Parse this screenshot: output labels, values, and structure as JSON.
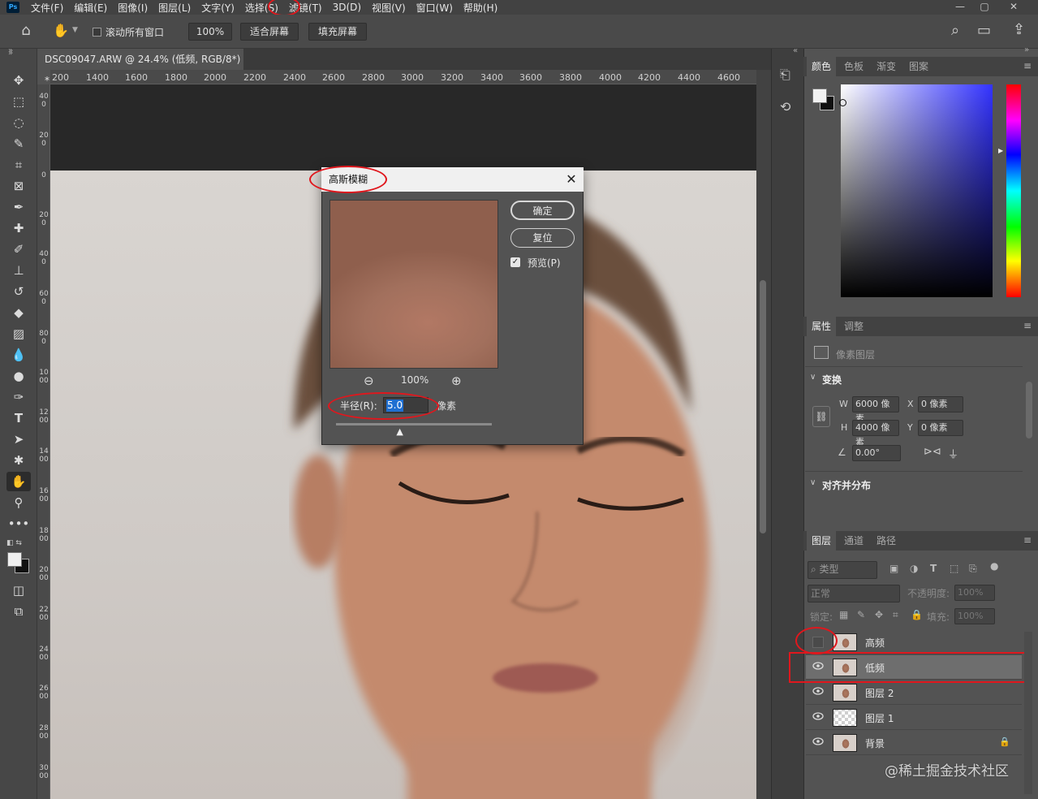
{
  "menubar": {
    "app_icon": "Ps",
    "items": [
      "文件(F)",
      "编辑(E)",
      "图像(I)",
      "图层(L)",
      "文字(Y)",
      "选择(S)",
      "滤镜(T)",
      "3D(D)",
      "视图(V)",
      "窗口(W)",
      "帮助(H)"
    ],
    "win_minimize": "—",
    "win_restore": "▢",
    "win_close": "✕"
  },
  "optionsbar": {
    "home_icon": "⌂",
    "hand_icon": "✋",
    "scroll_all_label": "滚动所有窗口",
    "zoom_value": "100%",
    "fit_screen_label": "适合屏幕",
    "fill_screen_label": "填充屏幕",
    "search_icon": "⌕",
    "workspace_icon": "▭",
    "share_icon": "⇪"
  },
  "document": {
    "tab_title": "DSC09047.ARW @ 24.4% (低频, RGB/8*) *",
    "tab_close": "×",
    "ruler_top": [
      "200",
      "1400",
      "1600",
      "1800",
      "2000",
      "2200",
      "2400",
      "2600",
      "2800",
      "3000",
      "3200",
      "3400",
      "3600",
      "3800",
      "4000",
      "4200",
      "4400",
      "4600"
    ],
    "ruler_left": [
      "400",
      "200",
      "0",
      "200",
      "400",
      "600",
      "800",
      "1000",
      "1200",
      "1400",
      "1600",
      "1800",
      "2000",
      "2200",
      "2400",
      "2600",
      "2800",
      "3000"
    ]
  },
  "dialog": {
    "title": "高斯模糊",
    "close": "✕",
    "ok_label": "确定",
    "reset_label": "复位",
    "preview_label": "预览(P)",
    "preview_checked": "✓",
    "zoom_out_icon": "⊖",
    "zoom_value": "100%",
    "zoom_in_icon": "⊕",
    "radius_label": "半径(R):",
    "radius_value": "5.0",
    "radius_unit": "像素",
    "slider_handle": "▲",
    "slider_fraction": 0.2
  },
  "color_panel": {
    "tabs": [
      "颜色",
      "色板",
      "渐变",
      "图案"
    ],
    "menu_icon": "≡"
  },
  "properties_panel": {
    "tabs": [
      "属性",
      "调整"
    ],
    "menu_icon": "≡",
    "layer_type": "像素图层",
    "transform_title": "变换",
    "w_label": "W",
    "w_value": "6000 像素",
    "x_label": "X",
    "x_value": "0 像素",
    "h_label": "H",
    "h_value": "4000 像素",
    "y_label": "Y",
    "y_value": "0 像素",
    "angle_value": "0.00°",
    "align_title": "对齐并分布"
  },
  "layers_panel": {
    "tabs": [
      "图层",
      "通道",
      "路径"
    ],
    "menu_icon": "≡",
    "filter_placeholder": "类型",
    "blend_mode": "正常",
    "opacity_label": "不透明度:",
    "opacity_value": "100%",
    "lock_label": "锁定:",
    "fill_label": "填充:",
    "fill_value": "100%",
    "layers": [
      {
        "name": "高频",
        "visible": false,
        "selected": false,
        "thumb": "photo",
        "locked": false
      },
      {
        "name": "低频",
        "visible": true,
        "selected": true,
        "thumb": "photo",
        "locked": false
      },
      {
        "name": "图层 2",
        "visible": true,
        "selected": false,
        "thumb": "photo",
        "locked": false
      },
      {
        "name": "图层 1",
        "visible": true,
        "selected": false,
        "thumb": "checker",
        "locked": false
      },
      {
        "name": "背景",
        "visible": true,
        "selected": false,
        "thumb": "photo",
        "locked": true
      }
    ],
    "eye_icon": "👁",
    "lock_icon": "🔒"
  },
  "watermark": "@稀土掘金技术社区",
  "annotation_color": "#e0171d"
}
